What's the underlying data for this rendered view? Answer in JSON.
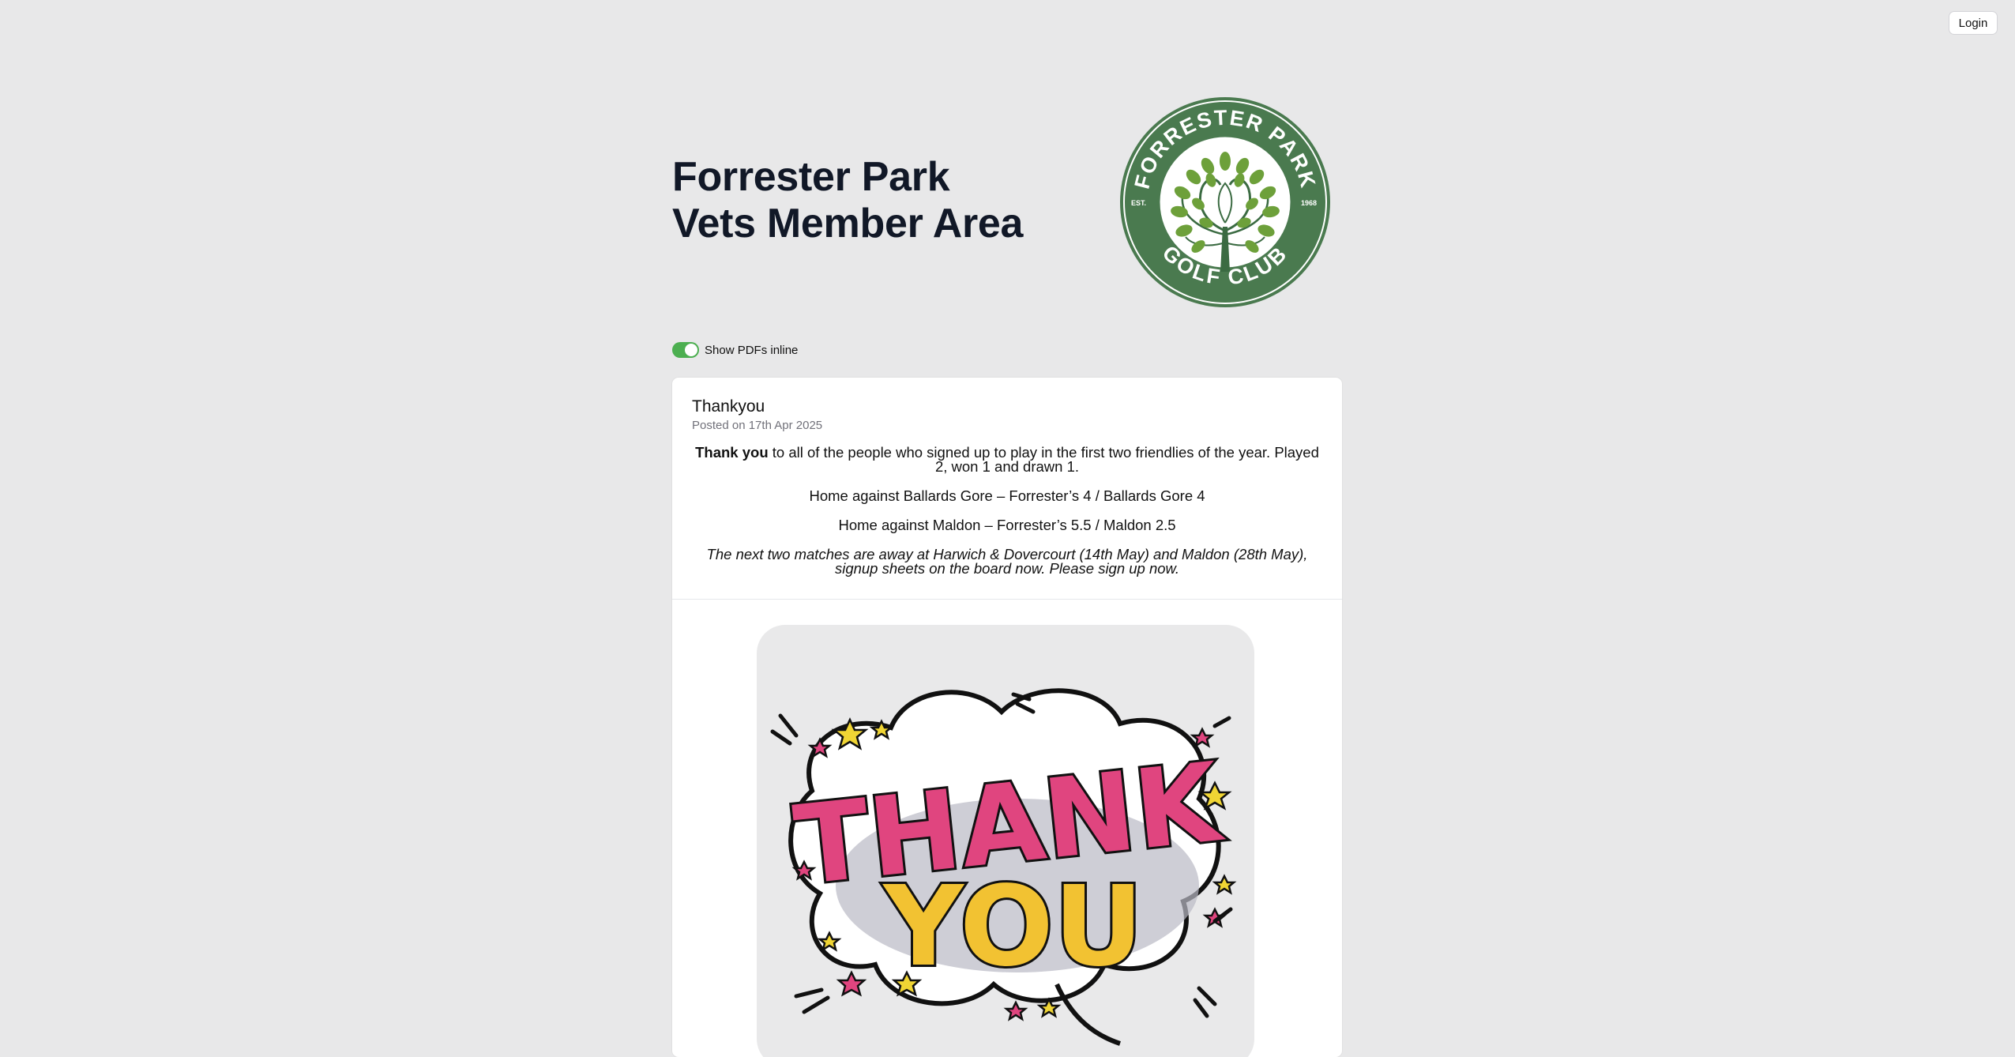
{
  "header": {
    "login_label": "Login"
  },
  "hero": {
    "title_line1": "Forrester Park",
    "title_line2": "Vets Member Area",
    "logo": {
      "top_text": "FORRESTER PARK",
      "bottom_text": "GOLF CLUB",
      "est_label": "EST.",
      "est_year": "1968",
      "colors": {
        "ring": "#4a7a4f",
        "leaf": "#6da03a",
        "trunk": "#3b6b42"
      }
    }
  },
  "settings": {
    "show_pdfs_label": "Show PDFs inline",
    "show_pdfs_enabled": true,
    "toggle_color": "#4caf50"
  },
  "post": {
    "title": "Thankyou",
    "date": "Posted on 17th Apr 2025",
    "intro_bold": "Thank you",
    "intro_rest": " to all of the people who signed up to play in the first two friendlies of the year. Played 2, won 1 and drawn 1.",
    "result_1": "Home against Ballards Gore – Forrester’s 4 / Ballards Gore 4",
    "result_2": "Home against Maldon – Forrester’s 5.5 / Maldon 2.5",
    "next_matches": "The next two matches are away at Harwich & Dovercourt (14th May) and Maldon (28th May), signup sheets on the board now. Please sign up now.",
    "image": {
      "text_line1": "THANK",
      "text_line2": "YOU"
    }
  }
}
